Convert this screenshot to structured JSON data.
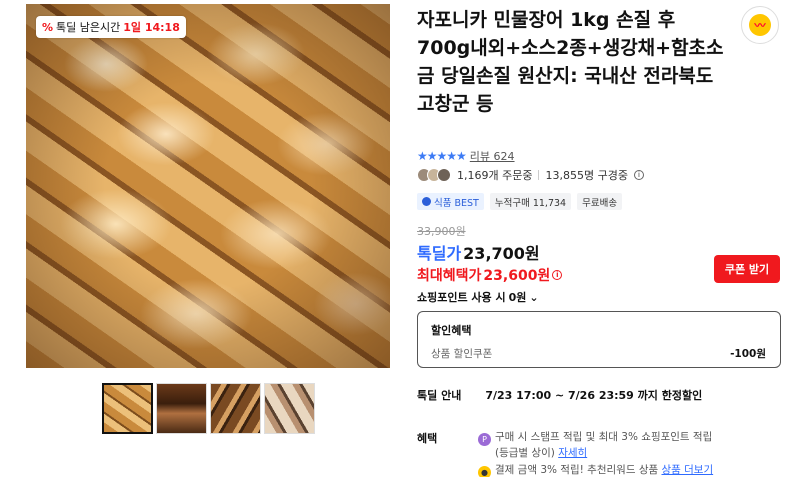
{
  "badge": {
    "label": "톡딜 남은시간",
    "time": "1일 14:18",
    "icon": "percent-icon"
  },
  "thumbnails": [
    "thumb-1",
    "thumb-2",
    "thumb-3",
    "thumb-4"
  ],
  "product": {
    "title": "자포니카 민물장어 1kg 손질 후 700g내외+소스2종+생강채+함초소금 당일손질 원산지: 국내산 전라북도 고창군 등",
    "share_icon": "share-icon"
  },
  "rating": {
    "stars": "★★★★★",
    "review_label": "리뷰 624"
  },
  "buyers": {
    "order_count": "1,169개 주문중",
    "viewers": "13,855명 구경중"
  },
  "tags": {
    "best": "식품 BEST",
    "cumulative": "누적구매 11,734",
    "shipping": "무료배송"
  },
  "price": {
    "original": "33,900원",
    "deal_label": "톡딜가",
    "deal_value": "23,700원",
    "max_label": "최대혜택가",
    "max_value": "23,600원",
    "coupon_button": "쿠폰 받기",
    "points_label": "쇼핑포인트 사용 시",
    "points_value": "0원"
  },
  "discount": {
    "title": "할인혜택",
    "item": "상품 할인쿠폰",
    "amount": "-100원"
  },
  "deal_info": {
    "label": "톡딜 안내",
    "period": "7/23 17:00 ~ 7/26 23:59 까지 한정할인"
  },
  "benefit": {
    "label": "혜택",
    "line1": "구매 시 스탬프 적립 및 최대 3% 쇼핑포인트 적립",
    "line1b": "(등급별 상이)",
    "line1_link": "자세히",
    "line2": "결제 금액 3% 적립! 추천리워드 상품",
    "line2_link": "상품 더보기"
  },
  "colors": {
    "accent_red": "#f0191e",
    "accent_blue": "#2f6bff",
    "kakao_yellow": "#ffc600"
  }
}
